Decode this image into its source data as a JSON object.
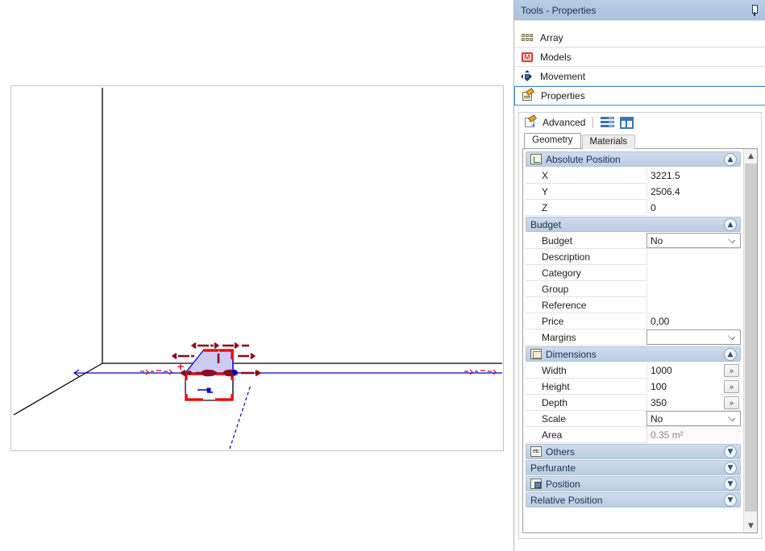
{
  "panel": {
    "title": "Tools - Properties",
    "pin_icon": "pin-icon"
  },
  "nav": {
    "items": [
      {
        "label": "Array",
        "icon": "array-icon",
        "selected": false
      },
      {
        "label": "Models",
        "icon": "models-icon",
        "selected": false
      },
      {
        "label": "Movement",
        "icon": "movement-icon",
        "selected": false
      },
      {
        "label": "Properties",
        "icon": "properties-icon",
        "selected": true
      }
    ]
  },
  "advanced": {
    "label": "Advanced",
    "icon": "advanced-properties-icon",
    "buttons": [
      {
        "name": "categorized-view-icon"
      },
      {
        "name": "grid-view-icon"
      }
    ]
  },
  "tabs": [
    {
      "label": "Geometry",
      "active": true
    },
    {
      "label": "Materials",
      "active": false
    }
  ],
  "grid": {
    "sections": [
      {
        "title": "Absolute Position",
        "icon": "axes-icon",
        "chevron": "chevron-up-icon",
        "expanded": true,
        "rows": [
          {
            "label": "X",
            "value": "3221.5",
            "type": "text"
          },
          {
            "label": "Y",
            "value": "2506.4",
            "type": "text"
          },
          {
            "label": "Z",
            "value": "0",
            "type": "text"
          }
        ]
      },
      {
        "title": "Budget",
        "icon": "",
        "chevron": "chevron-up-icon",
        "expanded": true,
        "rows": [
          {
            "label": "Budget",
            "value": "No",
            "type": "dropdown"
          },
          {
            "label": "Description",
            "value": "",
            "type": "text"
          },
          {
            "label": "Category",
            "value": "",
            "type": "text"
          },
          {
            "label": "Group",
            "value": "",
            "type": "text"
          },
          {
            "label": "Reference",
            "value": "",
            "type": "text"
          },
          {
            "label": "Price",
            "value": "0,00",
            "type": "text"
          },
          {
            "label": "Margins",
            "value": "",
            "type": "dropdown"
          }
        ]
      },
      {
        "title": "Dimensions",
        "icon": "dimensions-icon",
        "chevron": "chevron-up-icon",
        "expanded": true,
        "rows": [
          {
            "label": "Width",
            "value": "1000",
            "type": "text-button",
            "button": "»"
          },
          {
            "label": "Height",
            "value": "100",
            "type": "text-button",
            "button": "»"
          },
          {
            "label": "Depth",
            "value": "350",
            "type": "text-button",
            "button": "»"
          },
          {
            "label": "Scale",
            "value": "No",
            "type": "dropdown"
          },
          {
            "label": "Area",
            "value": "0.35 m²",
            "type": "readonly"
          }
        ]
      },
      {
        "title": "Others",
        "icon": "etc-icon",
        "chevron": "chevron-down-icon",
        "expanded": false,
        "rows": []
      },
      {
        "title": "Perfurante",
        "icon": "",
        "chevron": "chevron-down-icon",
        "expanded": false,
        "rows": []
      },
      {
        "title": "Position",
        "icon": "position-icon",
        "chevron": "chevron-down-icon",
        "expanded": false,
        "rows": []
      },
      {
        "title": "Relative Position",
        "icon": "",
        "chevron": "chevron-down-icon",
        "expanded": false,
        "rows": []
      }
    ]
  },
  "scrollbar": {
    "up": "scroll-up-arrow",
    "down": "scroll-down-arrow"
  },
  "viewport": {
    "name": "3d-model-viewport",
    "colors": {
      "axis": "#000000",
      "guide": "#0000cc",
      "selection": "#cc0000",
      "face_fill": "#ccccf2",
      "face_edge": "#0000cc"
    }
  }
}
